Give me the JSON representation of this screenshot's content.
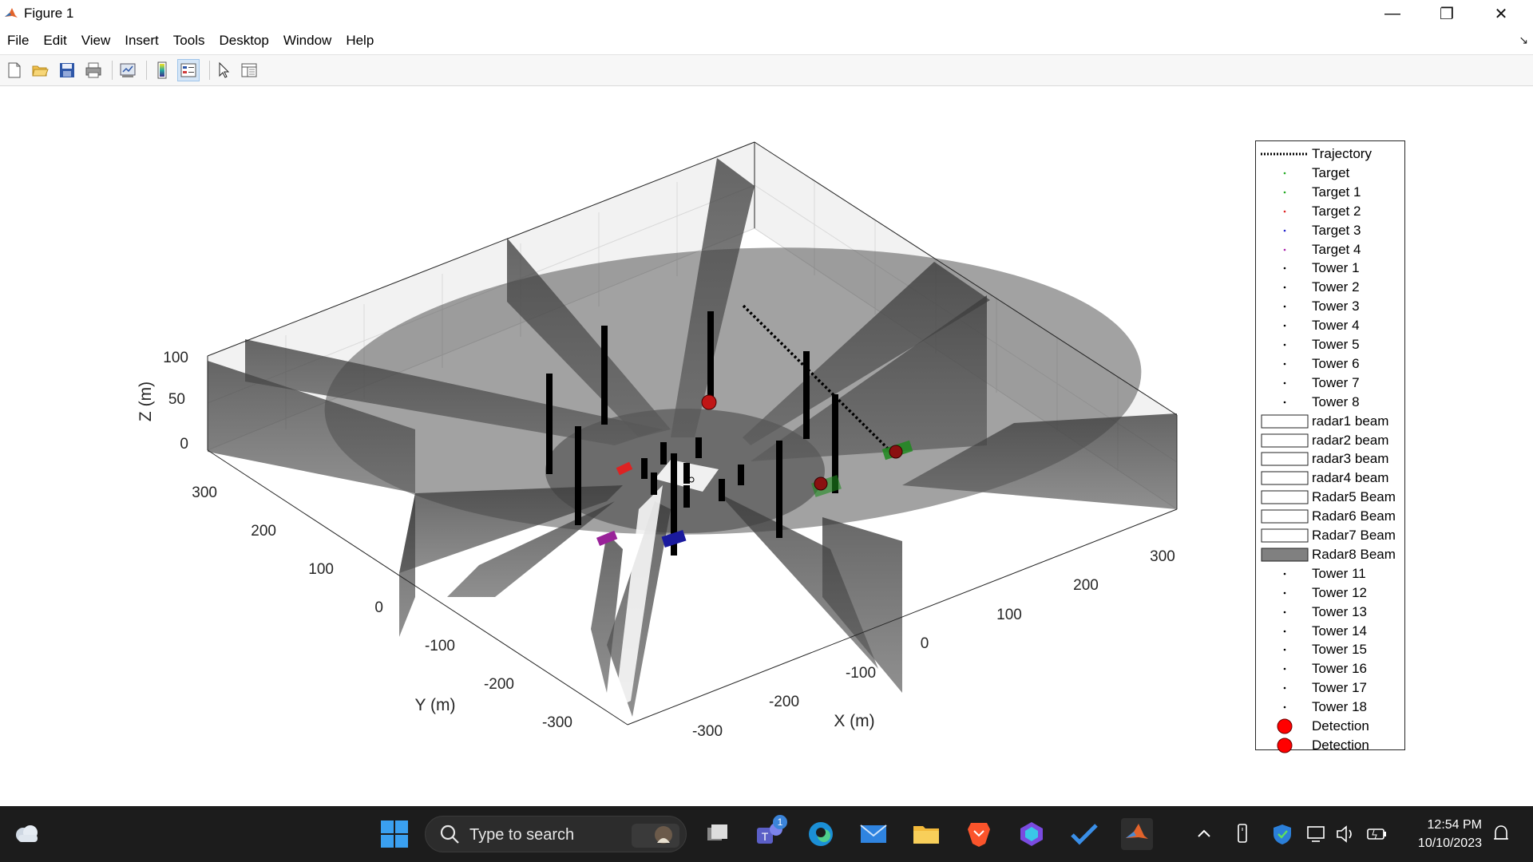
{
  "window": {
    "title": "Figure 1",
    "minimize": "—",
    "restore": "❐",
    "close": "✕"
  },
  "menu": [
    "File",
    "Edit",
    "View",
    "Insert",
    "Tools",
    "Desktop",
    "Window",
    "Help"
  ],
  "toolbar": {
    "buttons": [
      "new-figure-icon",
      "open-file-icon",
      "save-icon",
      "print-icon",
      "link-plot-icon",
      "colorbar-icon",
      "legend-icon",
      "pointer-icon",
      "property-inspector-icon"
    ]
  },
  "axes": {
    "x_label": "X (m)",
    "y_label": "Y (m)",
    "z_label": "Z (m)",
    "x_ticks": [
      "-300",
      "-200",
      "-100",
      "0",
      "100",
      "200",
      "300"
    ],
    "y_ticks": [
      "-300",
      "-200",
      "-100",
      "0",
      "100",
      "200",
      "300"
    ],
    "z_ticks": [
      "0",
      "50",
      "100"
    ]
  },
  "legend": {
    "entries": [
      {
        "label": "Trajectory",
        "symbol": "dotted-line",
        "color": "#000000"
      },
      {
        "label": "Target",
        "symbol": "dot",
        "color": "#22aa22"
      },
      {
        "label": "Target 1",
        "symbol": "dot",
        "color": "#22aa22"
      },
      {
        "label": "Target 2",
        "symbol": "dot",
        "color": "#dd2222"
      },
      {
        "label": "Target 3",
        "symbol": "dot",
        "color": "#2222cc"
      },
      {
        "label": "Target 4",
        "symbol": "dot",
        "color": "#aa22aa"
      },
      {
        "label": "Tower 1",
        "symbol": "dot",
        "color": "#000000"
      },
      {
        "label": "Tower 2",
        "symbol": "dot",
        "color": "#000000"
      },
      {
        "label": "Tower 3",
        "symbol": "dot",
        "color": "#000000"
      },
      {
        "label": "Tower 4",
        "symbol": "dot",
        "color": "#000000"
      },
      {
        "label": "Tower 5",
        "symbol": "dot",
        "color": "#000000"
      },
      {
        "label": "Tower 6",
        "symbol": "dot",
        "color": "#000000"
      },
      {
        "label": "Tower 7",
        "symbol": "dot",
        "color": "#000000"
      },
      {
        "label": "Tower 8",
        "symbol": "dot",
        "color": "#000000"
      },
      {
        "label": "radar1 beam",
        "symbol": "box",
        "color": "#ffffff"
      },
      {
        "label": "radar2 beam",
        "symbol": "box",
        "color": "#ffffff"
      },
      {
        "label": "radar3 beam",
        "symbol": "box",
        "color": "#ffffff"
      },
      {
        "label": "radar4 beam",
        "symbol": "box",
        "color": "#ffffff"
      },
      {
        "label": "Radar5 Beam",
        "symbol": "box",
        "color": "#ffffff"
      },
      {
        "label": "Radar6 Beam",
        "symbol": "box",
        "color": "#ffffff"
      },
      {
        "label": "Radar7 Beam",
        "symbol": "box",
        "color": "#ffffff"
      },
      {
        "label": "Radar8 Beam",
        "symbol": "box",
        "color": "#808080"
      },
      {
        "label": "Tower 11",
        "symbol": "dot",
        "color": "#000000"
      },
      {
        "label": "Tower 12",
        "symbol": "dot",
        "color": "#000000"
      },
      {
        "label": "Tower 13",
        "symbol": "dot",
        "color": "#000000"
      },
      {
        "label": "Tower 14",
        "symbol": "dot",
        "color": "#000000"
      },
      {
        "label": "Tower 15",
        "symbol": "dot",
        "color": "#000000"
      },
      {
        "label": "Tower 16",
        "symbol": "dot",
        "color": "#000000"
      },
      {
        "label": "Tower 17",
        "symbol": "dot",
        "color": "#000000"
      },
      {
        "label": "Tower 18",
        "symbol": "dot",
        "color": "#000000"
      },
      {
        "label": "Detection",
        "symbol": "circle",
        "color": "#ff0000"
      },
      {
        "label": "Detection",
        "symbol": "circle",
        "color": "#ff0000"
      }
    ]
  },
  "taskbar": {
    "search_placeholder": "Type to search",
    "time": "12:54 PM",
    "date": "10/10/2023",
    "teams_badge": "1"
  }
}
